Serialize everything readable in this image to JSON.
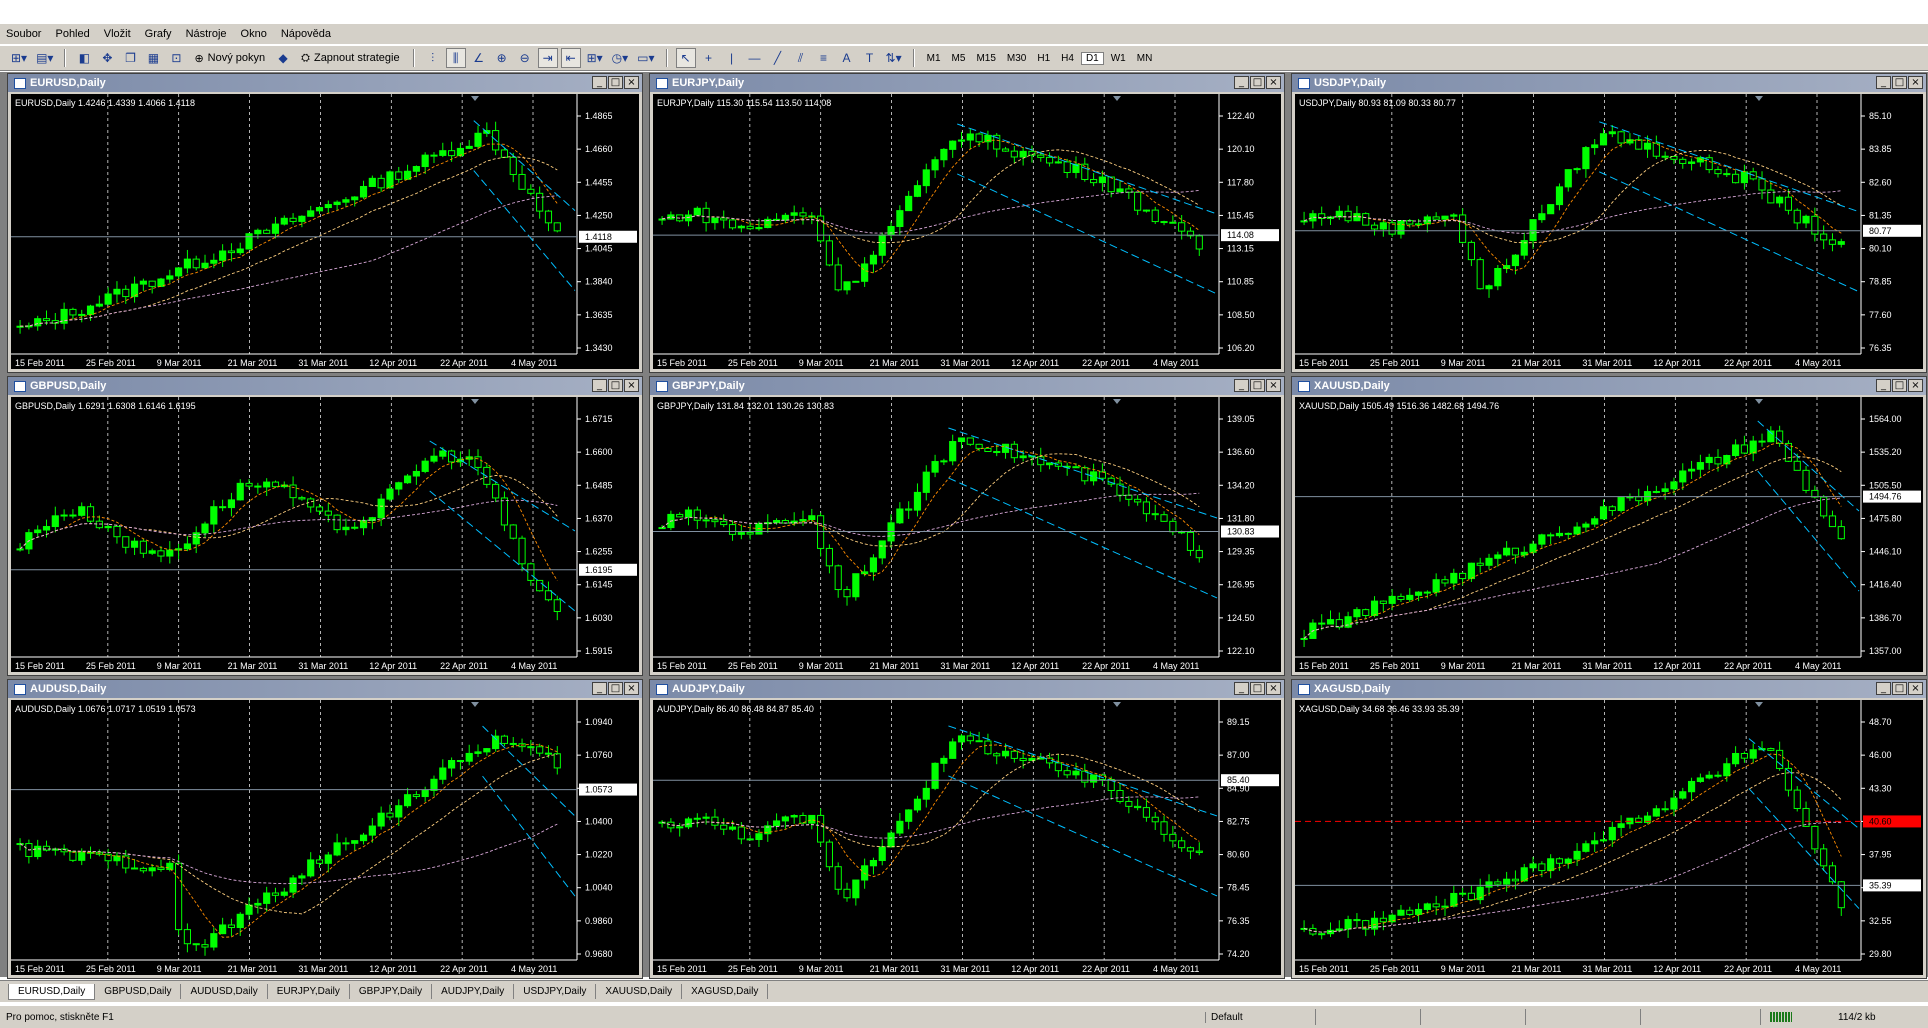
{
  "menu": [
    "Soubor",
    "Pohled",
    "Vložit",
    "Grafy",
    "Nástroje",
    "Okno",
    "Nápověda"
  ],
  "toolbar": {
    "new_order": "Nový pokyn",
    "strategies": "Zapnout strategie",
    "timeframes": [
      "M1",
      "M5",
      "M15",
      "M30",
      "H1",
      "H4",
      "D1",
      "W1",
      "MN"
    ],
    "active_timeframe": "D1"
  },
  "colors": {
    "bull": "#00ff00",
    "bear": "#000000",
    "grid": "#ffffff",
    "channel": "#00bfff",
    "ma_fast": "#ff8c00",
    "ma_mid": "#ffd080",
    "ma_slow": "#d8a8d8",
    "price_line": "#8090a0"
  },
  "x_labels": [
    "15 Feb 2011",
    "25 Feb 2011",
    "9 Mar 2011",
    "21 Mar 2011",
    "31 Mar 2011",
    "12 Apr 2011",
    "22 Apr 2011",
    "4 May 2011"
  ],
  "charts": [
    {
      "title": "EURUSD,Daily",
      "info": "EURUSD,Daily  1.4246 1.4339 1.4066 1.4118",
      "y_ticks": [
        "1.4865",
        "1.4660",
        "1.4455",
        "1.4250",
        "1.4045",
        "1.3840",
        "1.3635",
        "1.3430"
      ],
      "y_min": 1.343,
      "y_max": 1.4865,
      "current": "1.4118",
      "shape": "up_then_down"
    },
    {
      "title": "EURJPY,Daily",
      "info": "EURJPY,Daily  115.30 115.54 113.50 114.08",
      "y_ticks": [
        "122.40",
        "120.10",
        "117.80",
        "115.45",
        "113.15",
        "110.85",
        "108.50",
        "106.20"
      ],
      "y_min": 106.2,
      "y_max": 122.4,
      "current": "114.08",
      "shape": "dip_rally_fall"
    },
    {
      "title": "USDJPY,Daily",
      "info": "USDJPY,Daily  80.93 81.09 80.33 80.77",
      "y_ticks": [
        "85.10",
        "83.85",
        "82.60",
        "81.35",
        "80.10",
        "78.85",
        "77.60",
        "76.35"
      ],
      "y_min": 76.35,
      "y_max": 85.1,
      "current": "80.77",
      "shape": "dip_rally_fall"
    },
    {
      "title": "GBPUSD,Daily",
      "info": "GBPUSD,Daily  1.6291 1.6308 1.6146 1.6195",
      "y_ticks": [
        "1.6715",
        "1.6600",
        "1.6485",
        "1.6370",
        "1.6255",
        "1.6145",
        "1.6030",
        "1.5915"
      ],
      "y_min": 1.5915,
      "y_max": 1.6715,
      "current": "1.6195",
      "shape": "choppy_up_down"
    },
    {
      "title": "GBPJPY,Daily",
      "info": "GBPJPY,Daily  131.84 132.01 130.26 130.83",
      "y_ticks": [
        "139.05",
        "136.60",
        "134.20",
        "131.80",
        "129.35",
        "126.95",
        "124.50",
        "122.10"
      ],
      "y_min": 122.1,
      "y_max": 139.05,
      "current": "130.83",
      "shape": "dip_rally_fall"
    },
    {
      "title": "XAUUSD,Daily",
      "info": "XAUUSD,Daily  1505.49 1516.36 1482.68 1494.76",
      "y_ticks": [
        "1564.00",
        "1535.20",
        "1505.50",
        "1475.80",
        "1446.10",
        "1416.40",
        "1386.70",
        "1357.00"
      ],
      "y_min": 1357.0,
      "y_max": 1564.0,
      "current": "1494.76",
      "shape": "up_then_down"
    },
    {
      "title": "AUDUSD,Daily",
      "info": "AUDUSD,Daily  1.0676 1.0717 1.0519 1.0573",
      "y_ticks": [
        "1.0940",
        "1.0760",
        "1.0580",
        "1.0400",
        "1.0220",
        "1.0040",
        "0.9860",
        "0.9680"
      ],
      "y_min": 0.968,
      "y_max": 1.094,
      "current": "1.0573",
      "shape": "dip_then_up"
    },
    {
      "title": "AUDJPY,Daily",
      "info": "AUDJPY,Daily  86.40 86.48 84.87 85.40",
      "y_ticks": [
        "89.15",
        "87.00",
        "84.90",
        "82.75",
        "80.60",
        "78.45",
        "76.35",
        "74.20"
      ],
      "y_min": 74.2,
      "y_max": 89.15,
      "current": "85.40",
      "shape": "dip_rally_fall"
    },
    {
      "title": "XAGUSD,Daily",
      "info": "XAGUSD,Daily  34.68 36.46 33.93 35.39",
      "y_ticks": [
        "48.70",
        "46.00",
        "43.30",
        "40.60",
        "37.95",
        "35.25",
        "32.55",
        "29.80"
      ],
      "y_min": 29.8,
      "y_max": 48.7,
      "current": "35.39",
      "alert_level": "40.60",
      "shape": "spike_crash"
    }
  ],
  "tabs": [
    "EURUSD,Daily",
    "GBPUSD,Daily",
    "AUDUSD,Daily",
    "EURJPY,Daily",
    "GBPJPY,Daily",
    "AUDJPY,Daily",
    "USDJPY,Daily",
    "XAUUSD,Daily",
    "XAGUSD,Daily"
  ],
  "active_tab": "EURUSD,Daily",
  "status": {
    "help": "Pro pomoc, stiskněte F1",
    "profile": "Default",
    "traffic": "114/2 kb"
  }
}
